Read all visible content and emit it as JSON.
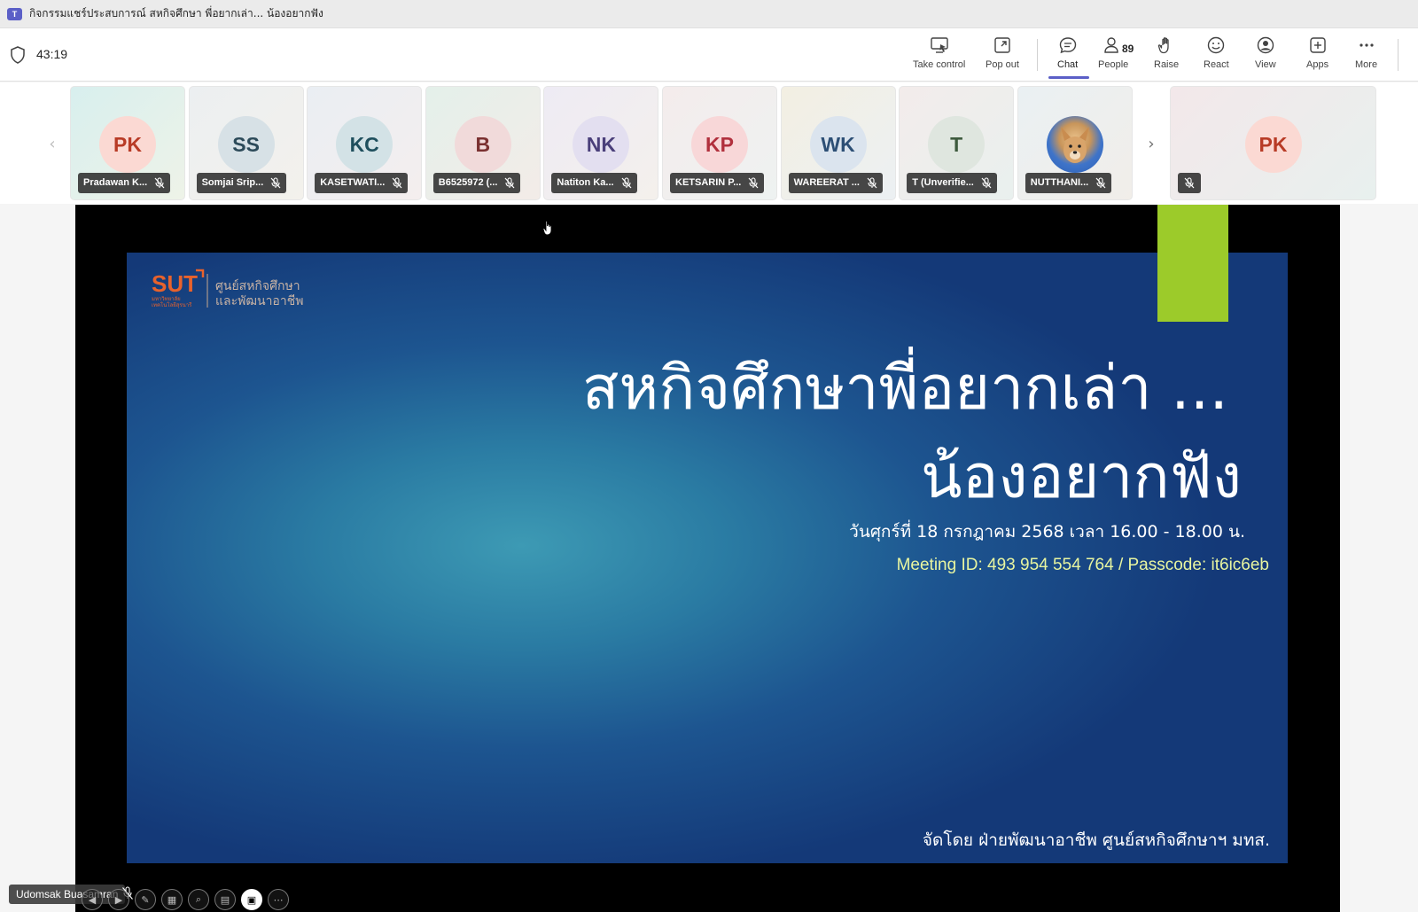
{
  "window": {
    "title": "กิจกรรมแชร์ประสบการณ์ สหกิจศึกษา พี่อยากเล่า... น้องอยากฟัง"
  },
  "meeting": {
    "timer": "43:19",
    "toolbar": {
      "take_control": "Take control",
      "pop_out": "Pop out",
      "chat": "Chat",
      "people": "People",
      "people_count": "89",
      "raise": "Raise",
      "react": "React",
      "view": "View",
      "apps": "Apps",
      "more": "More"
    }
  },
  "participants": [
    {
      "initials": "PK",
      "name": "Pradawan K...",
      "bg": "#fbd9d3",
      "fg": "#b83b26"
    },
    {
      "initials": "SS",
      "name": "Somjai Srip...",
      "bg": "#d7e1e6",
      "fg": "#2c4a59"
    },
    {
      "initials": "KC",
      "name": "KASETWATI...",
      "bg": "#d3e2e6",
      "fg": "#1f4f5d"
    },
    {
      "initials": "B",
      "name": "B6525972 (...",
      "bg": "#f1dada",
      "fg": "#7a3030"
    },
    {
      "initials": "NK",
      "name": "Natiton Ka...",
      "bg": "#e3dff0",
      "fg": "#4a3f7a"
    },
    {
      "initials": "KP",
      "name": "KETSARIN P...",
      "bg": "#f8d7d8",
      "fg": "#b1303d"
    },
    {
      "initials": "WK",
      "name": "WAREERAT ...",
      "bg": "#dbe4ee",
      "fg": "#2d4f75"
    },
    {
      "initials": "T",
      "name": "T (Unverifie...",
      "bg": "#dfe6df",
      "fg": "#3d5a3d"
    },
    {
      "initials": "",
      "name": "NUTTHANI...",
      "bg": "#3f74c9",
      "fg": "#ffffff"
    }
  ],
  "extra_tile": {
    "initials": "PK",
    "bg": "#fbd9d3",
    "fg": "#b83b26"
  },
  "slide": {
    "logo_text": "SUT",
    "logo_sub1": "มหาวิทยาลัย",
    "logo_sub2": "เทคโนโลยีสุรนารี",
    "logo_th1": "ศูนย์สหกิจศึกษา",
    "logo_th2": "และพัฒนาอาชีพ",
    "title_line1": "สหกิจศึกษาพี่อยากเล่า ...",
    "title_line2": "น้องอยากฟัง",
    "date": "วันศุกร์ที่ 18 กรกฎาคม 2568 เวลา 16.00 - 18.00 น.",
    "meeting": "Meeting ID: 493 954 554 764 / Passcode: it6ic6eb",
    "footer": "จัดโดย ฝ่ายพัฒนาอาชีพ ศูนย์สหกิจศึกษาฯ มทส.",
    "accent_color": "#9ccb2a"
  },
  "presenter": {
    "name": "Udomsak Buasamran"
  }
}
